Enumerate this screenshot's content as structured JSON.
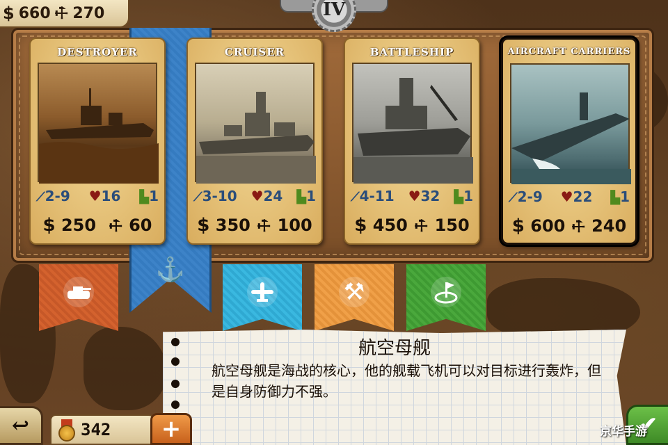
{
  "resources": {
    "money": "660",
    "parts": "270"
  },
  "tier": "IV",
  "units": [
    {
      "title": "DESTROYER",
      "range": "2-9",
      "hp": "16",
      "move": "1",
      "cost_money": "250",
      "cost_parts": "60"
    },
    {
      "title": "CRUISER",
      "range": "3-10",
      "hp": "24",
      "move": "1",
      "cost_money": "350",
      "cost_parts": "100"
    },
    {
      "title": "BATTLESHIP",
      "range": "4-11",
      "hp": "32",
      "move": "1",
      "cost_money": "450",
      "cost_parts": "150"
    },
    {
      "title": "AIRCRAFT CARRIERS",
      "range": "2-9",
      "hp": "22",
      "move": "1",
      "cost_money": "600",
      "cost_parts": "240"
    }
  ],
  "description": {
    "title": "航空母舰",
    "body": "航空母舰是海战的核心，他的舰载飞机可以对目标进行轰炸，但是自身防御力不强。"
  },
  "medals": "342",
  "watermark": "京华手游",
  "colors": {
    "navy_tab": "#3d83c8",
    "army_tab": "#d4622e",
    "air_tab": "#3ab8e0",
    "engineer_tab": "#f0a048",
    "objective_tab": "#4aa83c"
  },
  "icons": {
    "navy_tab": "anchor-icon",
    "army_tab": "tank-icon",
    "air_tab": "plane-icon",
    "engineer_tab": "tools-icon",
    "objective_tab": "flag-target-icon"
  }
}
